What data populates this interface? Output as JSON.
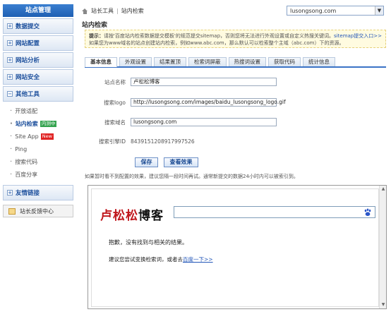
{
  "sidebar": {
    "header": "站点管理",
    "categories": [
      {
        "label": "数据提交"
      },
      {
        "label": "网站配置"
      },
      {
        "label": "网站分析"
      },
      {
        "label": "网站安全"
      },
      {
        "label": "其他工具"
      }
    ],
    "sub_items": [
      {
        "label": "开放适配"
      },
      {
        "label": "站内检索",
        "badge": "内测中"
      },
      {
        "label": "Site App",
        "badge": "New"
      },
      {
        "label": "Ping"
      },
      {
        "label": "搜索代码"
      },
      {
        "label": "百度分享"
      }
    ],
    "friend_links": "友情链接",
    "feedback": "站长反馈中心"
  },
  "topbar": {
    "breadcrumb": [
      "站长工具",
      "站内检索"
    ],
    "site_select": "lusongsong.com"
  },
  "page_title": "站内检索",
  "notice": {
    "prefix": "提示：",
    "text1": "请按'百度站内检索数据提交模板'的规范提交sitemap，否则您将无法进行外观设置或自定义热搜关键词。",
    "link": "sitemap提交入口>>",
    "text2": "如果您为www域名的站点创建站内检索，例如www.abc.com，那么默认可以检索整个主域（abc.com）下的资源。"
  },
  "tabs": [
    "基本信息",
    "外观设置",
    "结果置顶",
    "检索词屏蔽",
    "热搜词设置",
    "获取代码",
    "统计信息"
  ],
  "form": {
    "site_name_label": "站点名称",
    "site_name_value": "卢松松博客",
    "logo_label": "搜索logo",
    "logo_value": "http://lusongsong.com/images/baidu_lusongsong_logo.gif",
    "domain_label": "搜索域名",
    "domain_value": "lusongsong.com",
    "engine_id_label": "搜索引擎ID",
    "engine_id_value": "8439151208917997526",
    "save_label": "保存",
    "view_label": "查看效果"
  },
  "hint": "如果暂时看不到配置的效果，建议您隔一段时间再试。通常新提交的数据24小时内可以被索引到。",
  "preview": {
    "logo_red": "卢松松",
    "logo_black": "博客",
    "no_result": "抱歉，没有找到与相关的结果。",
    "suggest": "建议您尝试变换检索词，或者去",
    "suggest_link": "百度一下>>"
  }
}
